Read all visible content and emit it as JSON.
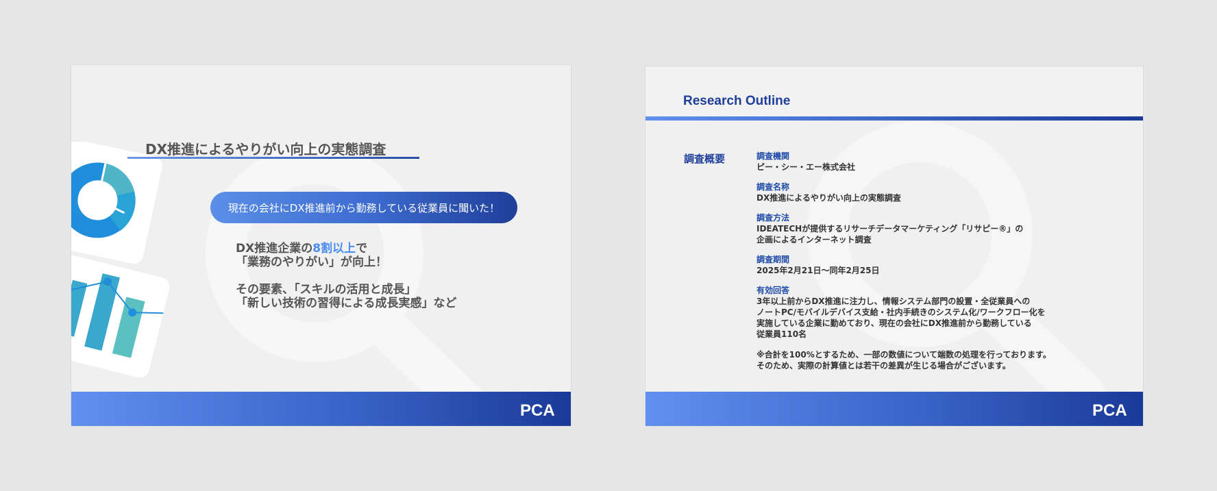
{
  "slide1": {
    "title": "DX推進によるやりがい向上の実態調査",
    "pill_text": "現在の会社にDX推進前から勤務している従業員に聞いた！",
    "body": {
      "line1_pre": "DX推進企業の",
      "line1_highlight": "8割以上",
      "line1_post": "で",
      "line2": "「業務のやりがい」が向上！",
      "line3": "その要素、「スキルの活用と成長」",
      "line4": "「新しい技術の習得による成長実感」など"
    },
    "logo": "PCA"
  },
  "slide2": {
    "title": "Research Outline",
    "section_label": "調査概要",
    "items": [
      {
        "label": "調査機関",
        "lines": [
          "ピー・シー・エー株式会社"
        ]
      },
      {
        "label": "調査名称",
        "lines": [
          "DX推進によるやりがい向上の実態調査"
        ]
      },
      {
        "label": "調査方法",
        "lines": [
          "IDEATECHが提供するリサーチデータマーケティング「リサピー®」の",
          "企画によるインターネット調査"
        ]
      },
      {
        "label": "調査期間",
        "lines": [
          "2025年2月21日〜同年2月25日"
        ]
      },
      {
        "label": "有効回答",
        "lines": [
          "3年以上前からDX推進に注力し、情報システム部門の設置・全従業員への",
          "ノートPC/モバイルデバイス支給・社内手続きのシステム化/ワークフロー化を",
          "実施している企業に勤めており、現在の会社にDX推進前から勤務している",
          "従業員110名"
        ]
      }
    ],
    "note_lines": [
      "※合計を100%とするため、一部の数値について端数の処理を行っております。",
      "そのため、実際の計算値とは若干の差異が生じる場合がございます。"
    ],
    "logo": "PCA"
  },
  "colors": {
    "accent_blue": "#1e3e9a",
    "highlight": "#4a8cf0",
    "footer_start": "#6090f0",
    "footer_end": "#1a3a98"
  }
}
